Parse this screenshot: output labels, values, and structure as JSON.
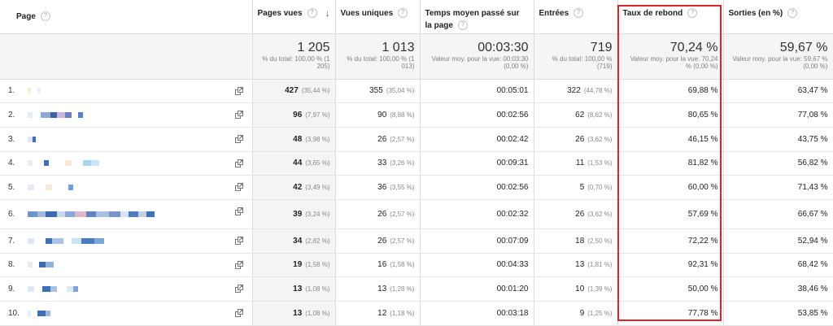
{
  "columns": [
    {
      "label": "Page"
    },
    {
      "label": "Pages vues"
    },
    {
      "label": "Vues uniques"
    },
    {
      "label": "Temps moyen passé sur la page"
    },
    {
      "label": "Entrées"
    },
    {
      "label": "Taux de rebond"
    },
    {
      "label": "Sorties (en %)"
    }
  ],
  "help_glyph": "?",
  "sort_glyph": "↓",
  "totals": [
    {
      "value": "1 205",
      "sub": "% du total: 100,00 % (1 205)"
    },
    {
      "value": "1 013",
      "sub": "% du total: 100,00 % (1 013)"
    },
    {
      "value": "00:03:30",
      "sub": "Valeur moy. pour la vue: 00:03:30 (0,00 %)"
    },
    {
      "value": "719",
      "sub": "% du total: 100,00 % (719)"
    },
    {
      "value": "70,24 %",
      "sub": "Valeur moy. pour la vue: 70,24 % (0,00 %)"
    },
    {
      "value": "59,67 %",
      "sub": "Valeur moy. pour la vue: 59,67 % (0,00 %)"
    }
  ],
  "rows": [
    {
      "num": "1.",
      "pv": "427",
      "pv_pct": "(35,44 %)",
      "uv": "355",
      "uv_pct": "(35,04 %)",
      "time": "00:05:01",
      "ent": "322",
      "ent_pct": "(44,78 %)",
      "bounce": "69,88 %",
      "exit": "63,47 %"
    },
    {
      "num": "2.",
      "pv": "96",
      "pv_pct": "(7,97 %)",
      "uv": "90",
      "uv_pct": "(8,88 %)",
      "time": "00:02:56",
      "ent": "62",
      "ent_pct": "(8,62 %)",
      "bounce": "80,65 %",
      "exit": "77,08 %"
    },
    {
      "num": "3.",
      "pv": "48",
      "pv_pct": "(3,98 %)",
      "uv": "26",
      "uv_pct": "(2,57 %)",
      "time": "00:02:42",
      "ent": "26",
      "ent_pct": "(3,62 %)",
      "bounce": "46,15 %",
      "exit": "43,75 %"
    },
    {
      "num": "4.",
      "pv": "44",
      "pv_pct": "(3,65 %)",
      "uv": "33",
      "uv_pct": "(3,26 %)",
      "time": "00:09:31",
      "ent": "11",
      "ent_pct": "(1,53 %)",
      "bounce": "81,82 %",
      "exit": "56,82 %"
    },
    {
      "num": "5.",
      "pv": "42",
      "pv_pct": "(3,49 %)",
      "uv": "36",
      "uv_pct": "(3,55 %)",
      "time": "00:02:56",
      "ent": "5",
      "ent_pct": "(0,70 %)",
      "bounce": "60,00 %",
      "exit": "71,43 %"
    },
    {
      "num": "6.",
      "pv": "39",
      "pv_pct": "(3,24 %)",
      "uv": "26",
      "uv_pct": "(2,57 %)",
      "time": "00:02:32",
      "ent": "26",
      "ent_pct": "(3,62 %)",
      "bounce": "57,69 %",
      "exit": "66,67 %"
    },
    {
      "num": "7.",
      "pv": "34",
      "pv_pct": "(2,82 %)",
      "uv": "26",
      "uv_pct": "(2,57 %)",
      "time": "00:07:09",
      "ent": "18",
      "ent_pct": "(2,50 %)",
      "bounce": "72,22 %",
      "exit": "52,94 %"
    },
    {
      "num": "8.",
      "pv": "19",
      "pv_pct": "(1,58 %)",
      "uv": "16",
      "uv_pct": "(1,58 %)",
      "time": "00:04:33",
      "ent": "13",
      "ent_pct": "(1,81 %)",
      "bounce": "92,31 %",
      "exit": "68,42 %"
    },
    {
      "num": "9.",
      "pv": "13",
      "pv_pct": "(1,08 %)",
      "uv": "13",
      "uv_pct": "(1,28 %)",
      "time": "00:01:20",
      "ent": "10",
      "ent_pct": "(1,39 %)",
      "bounce": "50,00 %",
      "exit": "38,46 %"
    },
    {
      "num": "10.",
      "pv": "13",
      "pv_pct": "(1,08 %)",
      "uv": "12",
      "uv_pct": "(1,18 %)",
      "time": "00:03:18",
      "ent": "9",
      "ent_pct": "(1,25 %)",
      "bounce": "77,78 %",
      "exit": "53,85 %"
    }
  ],
  "colors": {
    "highlight": "#e0222a",
    "total_bg": "#f5f5f5",
    "pixel_blue": "#3f6fb5",
    "pixel_light": "#a9d4f0"
  },
  "icons": {
    "help": "help-circle-icon",
    "sort": "sort-descending-icon",
    "open_page": "open-external-icon"
  }
}
